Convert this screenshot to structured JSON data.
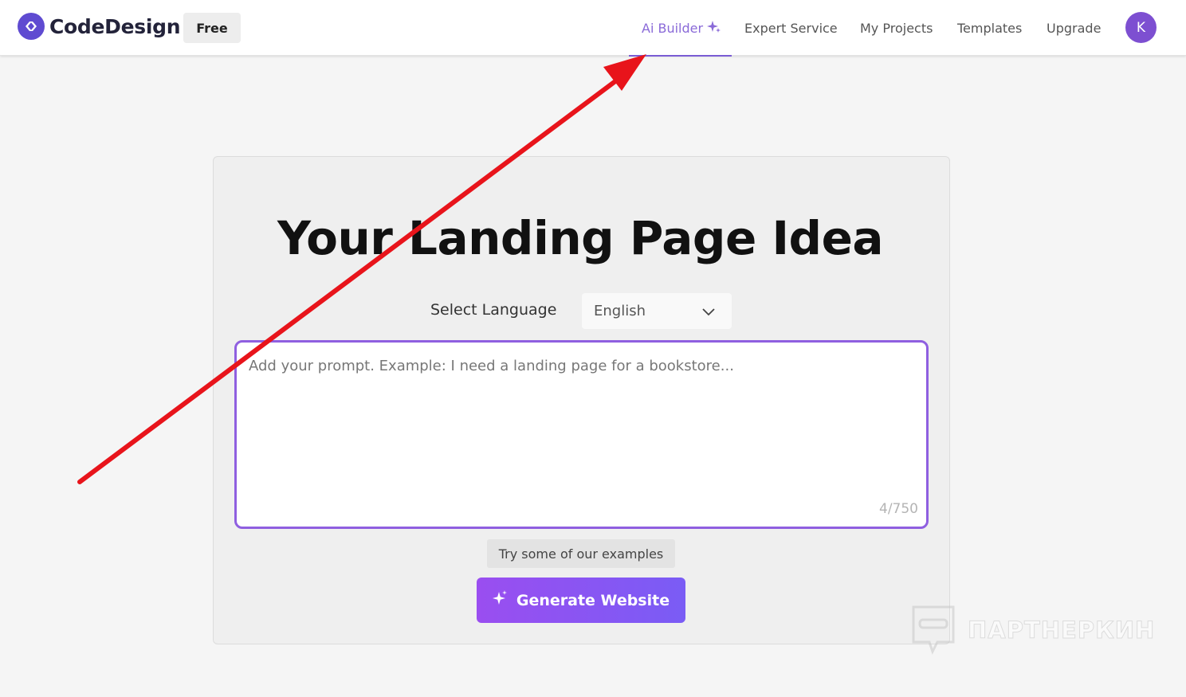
{
  "header": {
    "brand": "CodeDesign",
    "plan_badge": "Free",
    "nav": [
      {
        "label": "Ai Builder",
        "active": true,
        "icon": "sparkle-icon"
      },
      {
        "label": "Expert Service",
        "active": false
      },
      {
        "label": "My Projects",
        "active": false
      },
      {
        "label": "Templates",
        "active": false
      },
      {
        "label": "Upgrade",
        "active": false
      }
    ],
    "avatar_initial": "K"
  },
  "main": {
    "title": "Your Landing Page Idea",
    "language_label": "Select Language",
    "language_value": "English",
    "prompt_placeholder": "Add your prompt. Example: I need a landing page for a bookstore...",
    "prompt_value": "",
    "char_counter": "4/750",
    "examples_button": "Try some of our examples",
    "generate_button": "Generate Website"
  },
  "watermark": {
    "text": "ПАРТНЕРКИН"
  },
  "colors": {
    "accent": "#7a5cd4",
    "button_gradient_start": "#9a4ef0",
    "button_gradient_end": "#7a5cf5",
    "annotation_arrow": "#e8141b",
    "avatar_bg": "#7d4fd1"
  }
}
